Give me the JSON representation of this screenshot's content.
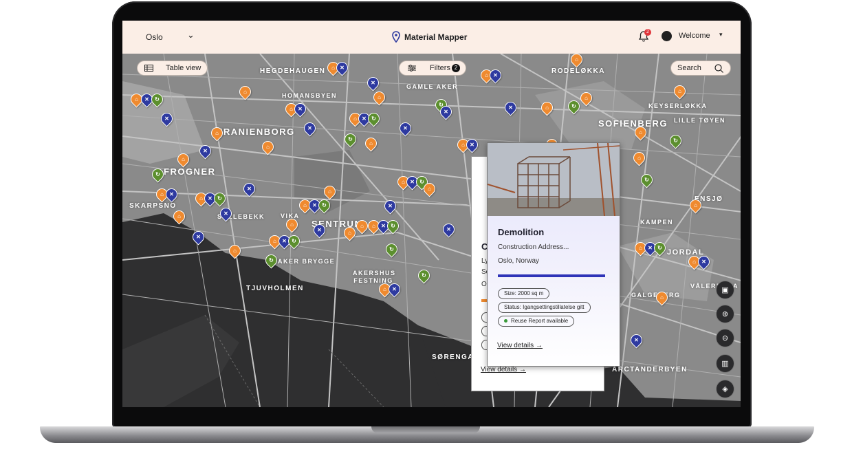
{
  "header": {
    "city": "Oslo",
    "app_title": "Material Mapper",
    "notification_count": "2",
    "welcome_label": "Welcome"
  },
  "toolbar": {
    "table_view_label": "Table view",
    "filters_label": "Filters",
    "filters_count": "2",
    "search_label": "Search"
  },
  "map_labels": [
    "HEGDEHAUGEN",
    "HOMANSBYEN",
    "GAMLE AKER",
    "RODELØKKA",
    "KEYSERLØKKA",
    "SOFIENBERG",
    "LILLE TØYEN",
    "URANIENBORG",
    "FROGNER",
    "SKARPSNO",
    "SOLLEBEKK",
    "VIKA",
    "SENTRUM",
    "AKER BRYGGE",
    "TJUVHOLMEN",
    "AKERSHUS FESTNING",
    "SØRENGA",
    "ENSJØ",
    "KAMPEN",
    "JORDAL",
    "VÅLERENGA",
    "GALGEBERG",
    "ARCTANDERBYEN"
  ],
  "back_card": {
    "title_initial": "C",
    "line1_initial": "Ly",
    "line2_initial": "Se",
    "line3_initial": "Os",
    "view_details": "View details →"
  },
  "card": {
    "title": "Demolition",
    "address": "Construction Address...",
    "city_country": "Oslo, Norway",
    "progress_fraction": 1.0,
    "size_tag": "Size: 2000 sq m",
    "status_tag": "Status: Igangsettingstillatelse gitt",
    "reuse_tag": "Reuse Report available",
    "view_details": "View details →"
  },
  "colors": {
    "topbar_bg": "#fbeee6",
    "pin_orange": "#ef8a2f",
    "pin_blue": "#2e3aa0",
    "pin_green": "#5c8f2e",
    "accent": "#2f34b8"
  },
  "map_controls": [
    "image-icon",
    "zoom-in-icon",
    "zoom-out-icon",
    "buildings-icon",
    "layers-icon"
  ]
}
